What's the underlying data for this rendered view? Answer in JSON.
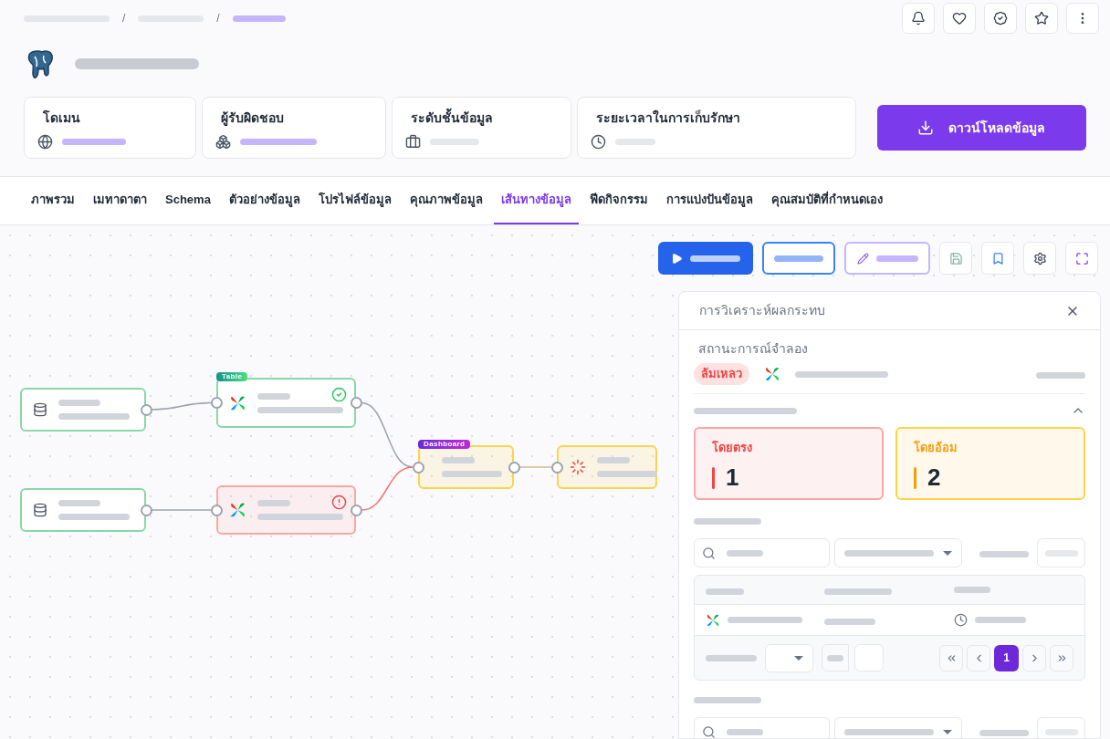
{
  "breadcrumb": {
    "separators": [
      "/",
      "/"
    ]
  },
  "info_cards": [
    {
      "label": "โดเมน",
      "kind": "linked"
    },
    {
      "label": "ผู้รับผิดชอบ",
      "kind": "linked"
    },
    {
      "label": "ระดับชั้นข้อมูล",
      "kind": "plain"
    },
    {
      "label": "ระยะเวลาในการเก็บรักษา",
      "kind": "plain"
    }
  ],
  "download_button": {
    "label": "ดาวน์โหลดข้อมูล"
  },
  "tabs": [
    {
      "label": "ภาพรวม",
      "selected": false
    },
    {
      "label": "เมทาดาตา",
      "selected": false
    },
    {
      "label": "Schema",
      "selected": false
    },
    {
      "label": "ตัวอย่างข้อมูล",
      "selected": false
    },
    {
      "label": "โปรไฟล์ข้อมูล",
      "selected": false
    },
    {
      "label": "คุณภาพข้อมูล",
      "selected": false
    },
    {
      "label": "เส้นทางข้อมูล",
      "selected": true
    },
    {
      "label": "ฟีดกิจกรรม",
      "selected": false
    },
    {
      "label": "การแบ่งปันข้อมูล",
      "selected": false
    },
    {
      "label": "คุณสมบัติที่กำหนดเอง",
      "selected": false
    }
  ],
  "lineage_nodes": [
    {
      "kind": "source",
      "color": "#86d9a8"
    },
    {
      "kind": "pipeline",
      "tag": "Table",
      "color": "#86d9a8",
      "failed": false
    },
    {
      "kind": "source",
      "color": "#86d9a8"
    },
    {
      "kind": "pipeline",
      "color": "#fca5a5",
      "failed": true
    },
    {
      "kind": "dashboard",
      "tag": "Dashboard",
      "color": "#fcd34d"
    },
    {
      "kind": "loading",
      "color": "#fcd34d"
    }
  ],
  "impact_panel": {
    "title": "การวิเคราะห์ผลกระทบ",
    "scenario_label": "สถานะการณ์จำลอง",
    "scenario_status": "ล้มเหลว",
    "section_expanded": true,
    "stats": [
      {
        "label": "โดยตรง",
        "value": "1",
        "kind": "direct"
      },
      {
        "label": "โดยอ้อม",
        "value": "2",
        "kind": "indirect"
      }
    ],
    "pages": [
      {
        "label": "1",
        "selected": true
      }
    ]
  }
}
